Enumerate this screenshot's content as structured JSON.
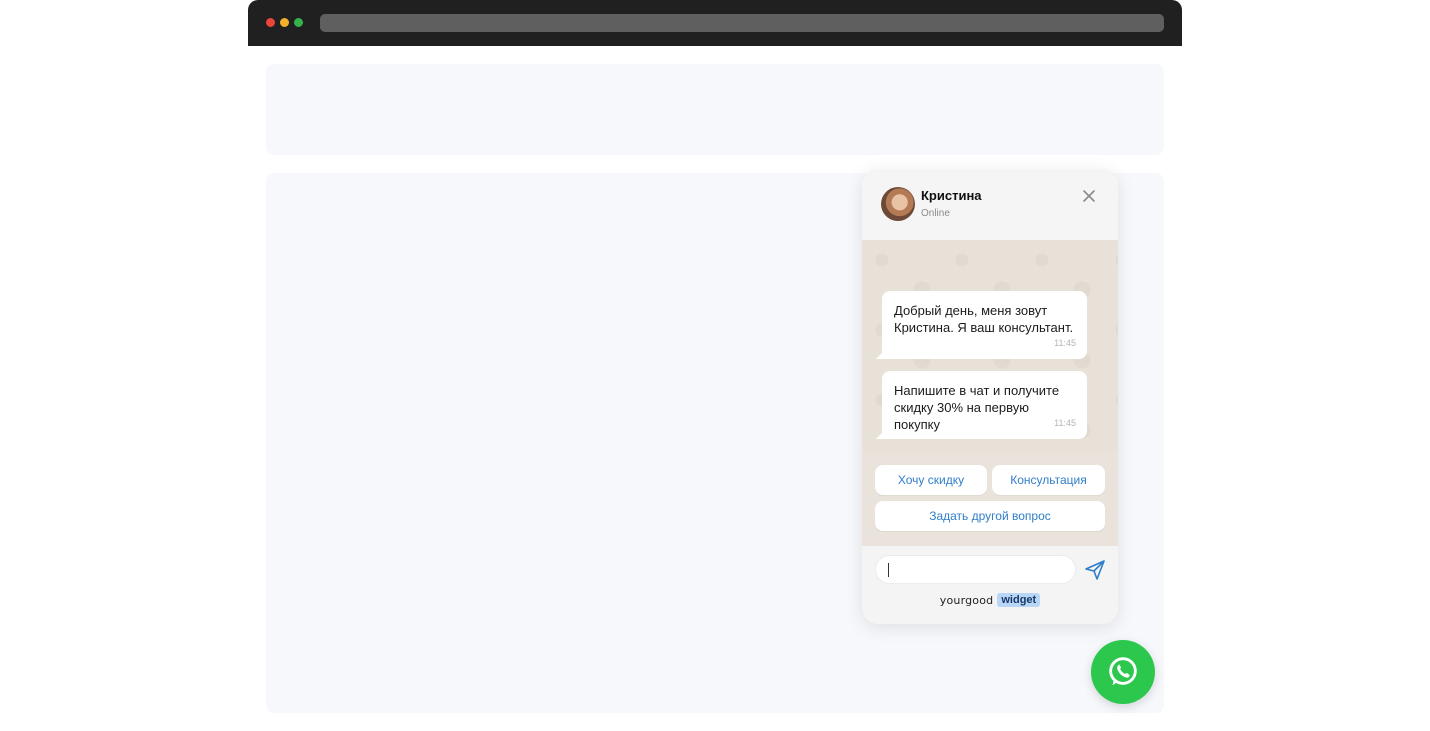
{
  "browser": {
    "window_controls": [
      "close",
      "minimize",
      "maximize"
    ],
    "colors": {
      "chrome": "#202020",
      "close": "#e94538",
      "minimize": "#f3b12b",
      "maximize": "#35b34a"
    }
  },
  "widget": {
    "agent_name": "Кристина",
    "agent_status": "Online",
    "close_icon": "close-icon",
    "messages": [
      {
        "text": "Добрый день, меня зовут Кристина. Я ваш консультант.",
        "time": "11:45"
      },
      {
        "text": "Напишите в чат и получите скидку 30% на первую покупку",
        "time": "11:45"
      }
    ],
    "quick_replies": [
      "Хочу скидку",
      "Консультация",
      "Задать другой вопрос"
    ],
    "input": {
      "value": "",
      "placeholder": ""
    },
    "send_icon": "send-icon",
    "brand": {
      "name": "yourgood",
      "badge": "widget"
    },
    "colors": {
      "chat_background": "#e8e1d8",
      "reply_text": "#2f7ec8",
      "badge_background": "#b9d6f6"
    }
  },
  "whatsapp_button": {
    "icon": "whatsapp-icon",
    "color": "#2cc84d"
  }
}
